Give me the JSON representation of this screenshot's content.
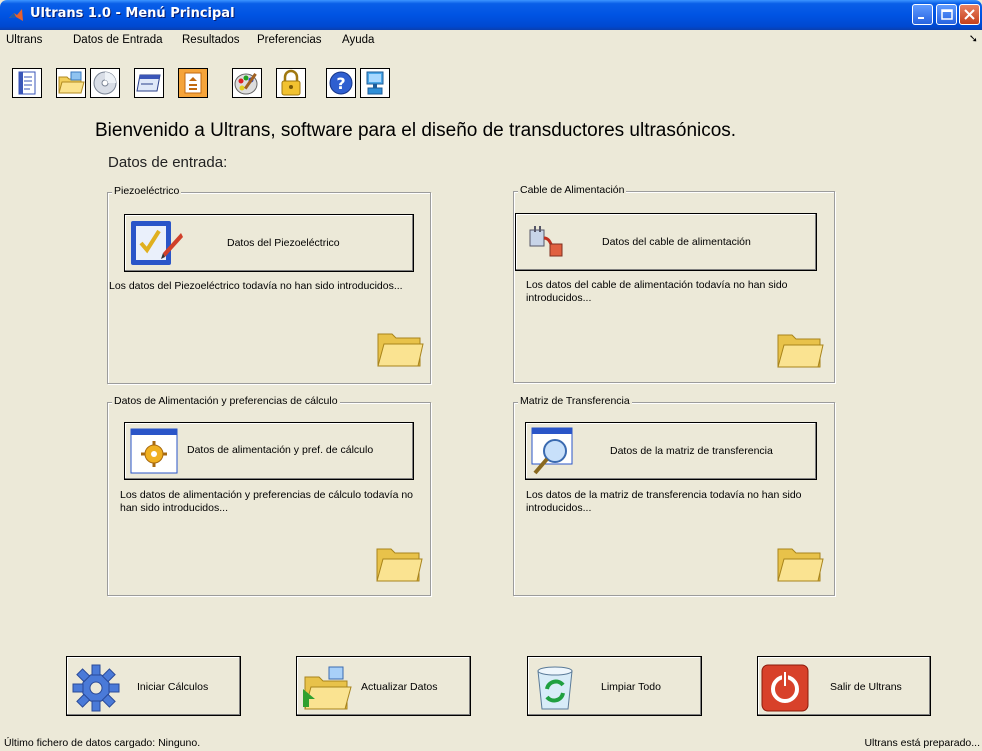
{
  "window": {
    "title": "Ultrans 1.0 - Menú Principal"
  },
  "menu": {
    "items": [
      "Ultrans",
      "Datos de Entrada",
      "Resultados",
      "Preferencias",
      "Ayuda"
    ]
  },
  "toolbar": {
    "icons": [
      "new-document-icon",
      "open-folder-icon",
      "cd-icon",
      "window-icon",
      "stack-icon",
      "palette-icon",
      "lock-icon",
      "help-icon",
      "monitor-icon"
    ]
  },
  "main": {
    "welcome": "Bienvenido a Ultrans, software para el diseño de transductores ultrasónicos.",
    "datos_heading": "Datos de entrada:"
  },
  "panels": [
    {
      "title": "Piezoeléctrico",
      "button_label": "Datos del Piezoeléctrico",
      "status_text": "Los datos del Piezoeléctrico todavía no han sido introducidos..."
    },
    {
      "title": "Cable de Alimentación",
      "button_label": "Datos del cable de alimentación",
      "status_text": "Los datos del cable de alimentación todavía no han sido introducidos..."
    },
    {
      "title": "Datos de Alimentación y preferencias de cálculo",
      "button_label": "Datos de alimentación y pref. de cálculo",
      "status_text": "Los datos de alimentación y preferencias de cálculo todavía no han sido introducidos..."
    },
    {
      "title": "Matriz de Transferencia",
      "button_label": "Datos de la matriz de transferencia",
      "status_text": "Los datos de la matriz de transferencia todavía no han sido introducidos..."
    }
  ],
  "actions": {
    "iniciar": "Iniciar Cálculos",
    "actualizar": "Actualizar Datos",
    "limpiar": "Limpiar Todo",
    "salir": "Salir de Ultrans"
  },
  "status": {
    "left": "Último fichero de datos cargado: Ninguno.",
    "right": "Ultrans está preparado..."
  },
  "colors": {
    "titlebar": "#0054e3",
    "background": "#ece9d8",
    "folder": "#f7d76a",
    "power_button": "#d8412a"
  }
}
